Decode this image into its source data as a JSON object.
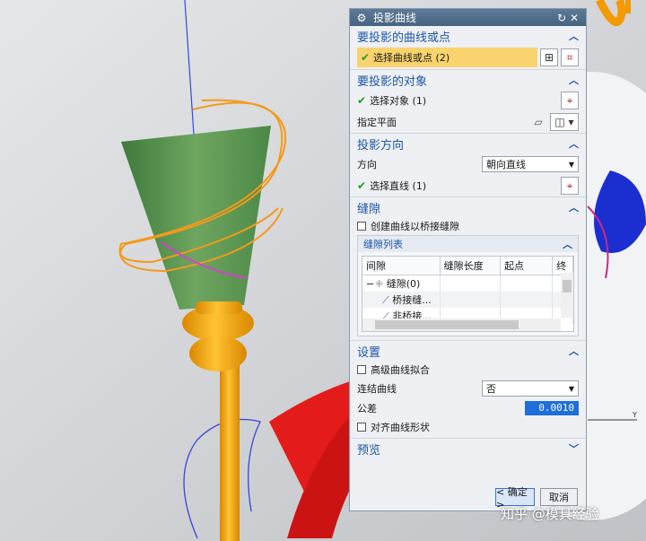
{
  "dialog": {
    "title": "投影曲线",
    "icons": {
      "title": "gear-icon",
      "reset": "reset-icon",
      "close": "close-icon"
    },
    "sections": {
      "curves": {
        "header": "要投影的曲线或点",
        "select_label": "选择曲线或点 (2)"
      },
      "objects": {
        "header": "要投影的对象",
        "select_label": "选择对象 (1)",
        "plane_label": "指定平面"
      },
      "direction": {
        "header": "投影方向",
        "dir_label": "方向",
        "dir_value": "朝向直线",
        "line_label": "选择直线 (1)"
      },
      "gap": {
        "header": "缝隙",
        "bridge_label": "创建曲线以桥接缝隙",
        "list_header": "缝隙列表",
        "columns": [
          "间隙",
          "缝隙长度",
          "起点",
          "终"
        ],
        "rows": [
          {
            "name": "缝隙(0)",
            "expand": "−"
          },
          {
            "name": "桥接缝...",
            "expand": ""
          },
          {
            "name": "非桥接...",
            "expand": ""
          }
        ]
      },
      "settings": {
        "header": "设置",
        "advanced_label": "高级曲线拟合",
        "connect_label": "连结曲线",
        "connect_value": "否",
        "tolerance_label": "公差",
        "tolerance_value": "0.0010",
        "align_label": "对齐曲线形状"
      },
      "preview": {
        "header": "预览"
      }
    },
    "buttons": {
      "ok": "< 确定 >",
      "cancel": "取消"
    }
  },
  "viewport": {
    "axis_label": "Y"
  },
  "watermark": "知乎 @模具经验",
  "colors": {
    "accent": "#1c56a8",
    "selection": "#f8d36e",
    "check": "#1f9d2b",
    "title_bar": "#46637f",
    "tolerance_field": "#1e6fd9"
  }
}
